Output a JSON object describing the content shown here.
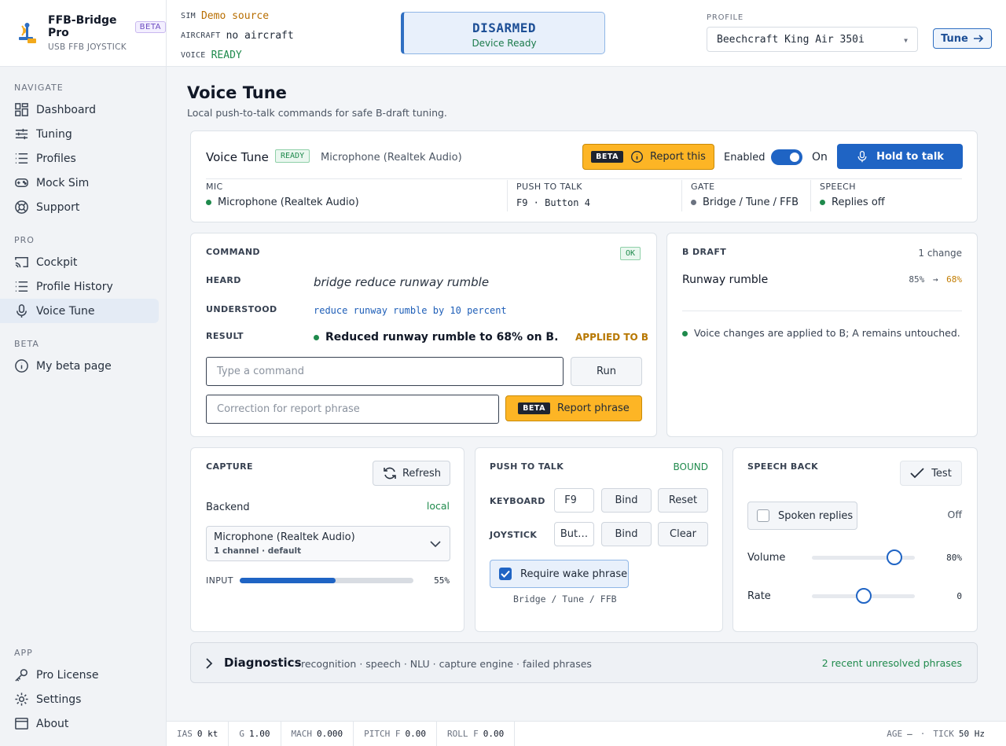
{
  "brand": {
    "name": "FFB-Bridge Pro",
    "badge": "BETA",
    "sub": "USB FFB JOYSTICK"
  },
  "nav": {
    "navigate_label": "NAVIGATE",
    "navigate": [
      "Dashboard",
      "Tuning",
      "Profiles",
      "Mock Sim",
      "Support"
    ],
    "pro_label": "PRO",
    "pro": [
      "Cockpit",
      "Profile History",
      "Voice Tune"
    ],
    "beta_label": "BETA",
    "beta": [
      "My beta page"
    ],
    "app_label": "APP",
    "app": [
      "Pro License",
      "Settings",
      "About"
    ]
  },
  "topbar": {
    "sim_key": "SIM",
    "sim_val": "Demo source",
    "aircraft_key": "AIRCRAFT",
    "aircraft_val": "no aircraft",
    "voice_key": "VOICE",
    "voice_val": "READY",
    "armed_title": "DISARMED",
    "armed_sub": "Device Ready",
    "profile_label": "PROFILE",
    "profile_value": "Beechcraft King Air 350i",
    "tune_label": "Tune"
  },
  "page": {
    "title": "Voice Tune",
    "subtitle": "Local push-to-talk commands for safe B-draft tuning."
  },
  "vt": {
    "title": "Voice Tune",
    "ready": "READY",
    "mic_name": "Microphone (Realtek Audio)",
    "beta": "BETA",
    "report": "Report this",
    "enabled": "Enabled",
    "on": "On",
    "hold": "Hold to talk",
    "mic_lbl": "MIC",
    "mic_val": "Microphone (Realtek Audio)",
    "ptt_lbl": "PUSH TO TALK",
    "ptt_val": "F9 · Button 4",
    "gate_lbl": "GATE",
    "gate_val": "Bridge / Tune / FFB",
    "speech_lbl": "SPEECH",
    "speech_val": "Replies off"
  },
  "command": {
    "label": "COMMAND",
    "ok": "OK",
    "heard_lbl": "HEARD",
    "heard": "bridge reduce runway rumble",
    "understood_lbl": "UNDERSTOOD",
    "understood": "reduce runway rumble by 10 percent",
    "result_lbl": "RESULT",
    "result": "Reduced runway rumble to 68% on B.",
    "applied": "APPLIED TO B",
    "input_placeholder": "Type a command",
    "run": "Run",
    "correction_placeholder": "Correction for report phrase",
    "beta": "BETA",
    "report_phrase": "Report phrase"
  },
  "draft": {
    "label": "B DRAFT",
    "changes": "1 change",
    "item": "Runway rumble",
    "from": "85%",
    "to": "68%",
    "note": "Voice changes are applied to B; A remains untouched."
  },
  "capture": {
    "label": "CAPTURE",
    "refresh": "Refresh",
    "backend_lbl": "Backend",
    "backend_val": "local",
    "device": "Microphone (Realtek Audio)",
    "device_sub": "1 channel · default",
    "input_lbl": "INPUT",
    "input_pct": "55%",
    "input_level": 0.55
  },
  "ptt": {
    "label": "PUSH TO TALK",
    "bound": "BOUND",
    "keyboard_lbl": "KEYBOARD",
    "keyboard_val": "F9",
    "bind": "Bind",
    "reset": "Reset",
    "joystick_lbl": "JOYSTICK",
    "joystick_val": "But…",
    "clear": "Clear",
    "wake": "Require wake phrase",
    "wake_phrase": "Bridge / Tune / FFB"
  },
  "speech": {
    "label": "SPEECH BACK",
    "test": "Test",
    "spoken": "Spoken replies",
    "spoken_state": "Off",
    "volume_lbl": "Volume",
    "volume_val": "80%",
    "volume": 0.8,
    "rate_lbl": "Rate",
    "rate_val": "0",
    "rate": 0.5
  },
  "diag": {
    "title": "Diagnostics",
    "sub": "recognition · speech · NLU · capture engine · failed phrases",
    "status": "2 recent unresolved phrases"
  },
  "footer": {
    "ias_k": "IAS",
    "ias_v": "0 kt",
    "g_k": "G",
    "g_v": "1.00",
    "mach_k": "MACH",
    "mach_v": "0.000",
    "pitch_k": "PITCH F",
    "pitch_v": "0.00",
    "roll_k": "ROLL F",
    "roll_v": "0.00",
    "age_k": "AGE",
    "age_v": "—",
    "sep": "·",
    "tick_k": "TICK",
    "tick_v": "50 Hz"
  },
  "colors": {
    "accent": "#1f64c4",
    "success": "#1f8a4c",
    "amber": "#fdb525"
  }
}
